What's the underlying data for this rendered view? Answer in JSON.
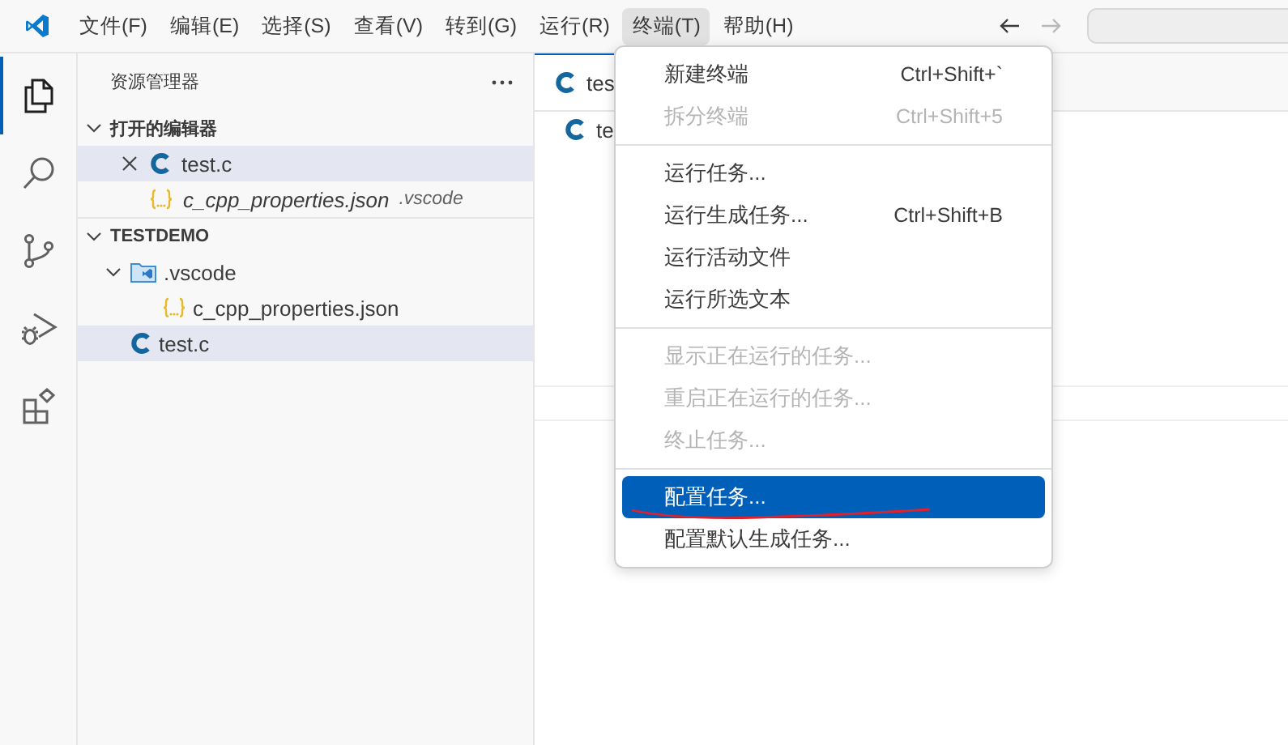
{
  "title_bar": {
    "menus": [
      {
        "label": "文件(F)",
        "selected": false
      },
      {
        "label": "编辑(E)",
        "selected": false
      },
      {
        "label": "选择(S)",
        "selected": false
      },
      {
        "label": "查看(V)",
        "selected": false
      },
      {
        "label": "转到(G)",
        "selected": false
      },
      {
        "label": "运行(R)",
        "selected": false
      },
      {
        "label": "终端(T)",
        "selected": true
      },
      {
        "label": "帮助(H)",
        "selected": false
      }
    ],
    "nav": [
      {
        "kind": "back",
        "disabled": false
      },
      {
        "kind": "forward",
        "disabled": true
      }
    ]
  },
  "activity_bar": [
    {
      "kind": "explorer",
      "selected": true
    },
    {
      "kind": "search",
      "selected": false
    },
    {
      "kind": "source-control",
      "selected": false
    },
    {
      "kind": "debug",
      "selected": false
    },
    {
      "kind": "extensions",
      "selected": false
    }
  ],
  "sidebar": {
    "title": "资源管理器",
    "sections": [
      {
        "label": "打开的编辑器",
        "expanded": true,
        "items": [
          {
            "name": "test.c",
            "kind": "c",
            "italic": false,
            "close": true,
            "selected": true
          },
          {
            "name": "c_cpp_properties.json",
            "kind": "json",
            "description": ".vscode",
            "italic": true,
            "close": false,
            "selected": false
          }
        ]
      },
      {
        "label": "TESTDEMO",
        "expanded": true,
        "items": [
          {
            "name": ".vscode",
            "kind": "folder",
            "expanded": true,
            "selected": false,
            "children": [
              {
                "name": "c_cpp_properties.json",
                "kind": "json",
                "selected": false
              }
            ]
          },
          {
            "name": "test.c",
            "kind": "c",
            "selected": true
          }
        ]
      }
    ]
  },
  "editor": {
    "tab": {
      "label": "tes",
      "kind": "c"
    },
    "breadcrumb": {
      "label": "te",
      "kind": "c"
    }
  },
  "menu": {
    "items": [
      {
        "kind": "item",
        "label": "新建终端",
        "shortcut": "Ctrl+Shift+`",
        "disabled": false,
        "selected": false
      },
      {
        "kind": "item",
        "label": "拆分终端",
        "shortcut": "Ctrl+Shift+5",
        "disabled": true,
        "selected": false
      },
      {
        "kind": "separator"
      },
      {
        "kind": "item",
        "label": "运行任务...",
        "disabled": false,
        "selected": false
      },
      {
        "kind": "item",
        "label": "运行生成任务...",
        "shortcut": "Ctrl+Shift+B",
        "disabled": false,
        "selected": false
      },
      {
        "kind": "item",
        "label": "运行活动文件",
        "disabled": false,
        "selected": false
      },
      {
        "kind": "item",
        "label": "运行所选文本",
        "disabled": false,
        "selected": false
      },
      {
        "kind": "separator"
      },
      {
        "kind": "item",
        "label": "显示正在运行的任务...",
        "disabled": true,
        "selected": false
      },
      {
        "kind": "item",
        "label": "重启正在运行的任务...",
        "disabled": true,
        "selected": false
      },
      {
        "kind": "item",
        "label": "终止任务...",
        "disabled": true,
        "selected": false
      },
      {
        "kind": "separator"
      },
      {
        "kind": "item",
        "label": "配置任务...",
        "disabled": false,
        "selected": true,
        "underlined": true
      },
      {
        "kind": "item",
        "label": "配置默认生成任务...",
        "disabled": false,
        "selected": false
      }
    ]
  }
}
